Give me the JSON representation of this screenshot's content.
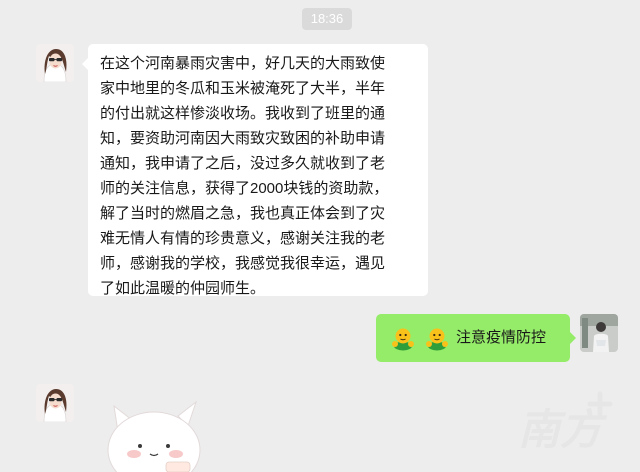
{
  "chat": {
    "timestamp": "18:36",
    "messages": [
      {
        "sender": "contact",
        "lines": [
          "在这个河南暴雨灾害中，好几天的大雨致使",
          "家中地里的冬瓜和玉米被淹死了大半，半年",
          "的付出就这样惨淡收场。我收到了班里的通",
          "知，要资助河南因大雨致灾致困的补助申请",
          "通知，我申请了之后，没过多久就收到了老",
          "师的关注信息，获得了2000块钱的资助款，",
          "解了当时的燃眉之急，我也真正体会到了灾",
          "难无情人有情的珍贵意义，感谢关注我的老",
          "师，感谢我的学校，我感觉我很幸运，遇见",
          "了如此温暖的仲园师生。"
        ]
      },
      {
        "sender": "self",
        "emoji": [
          "fist-emoji",
          "fist-emoji"
        ],
        "text": "注意疫情防控"
      },
      {
        "sender": "contact",
        "type": "sticker",
        "sticker": "white-cat-sticker"
      }
    ]
  },
  "watermark": {
    "text": "南方+",
    "color": "#e6e6e6"
  },
  "colors": {
    "background": "#ededed",
    "incoming_bubble": "#ffffff",
    "outgoing_bubble": "#95ec69"
  }
}
